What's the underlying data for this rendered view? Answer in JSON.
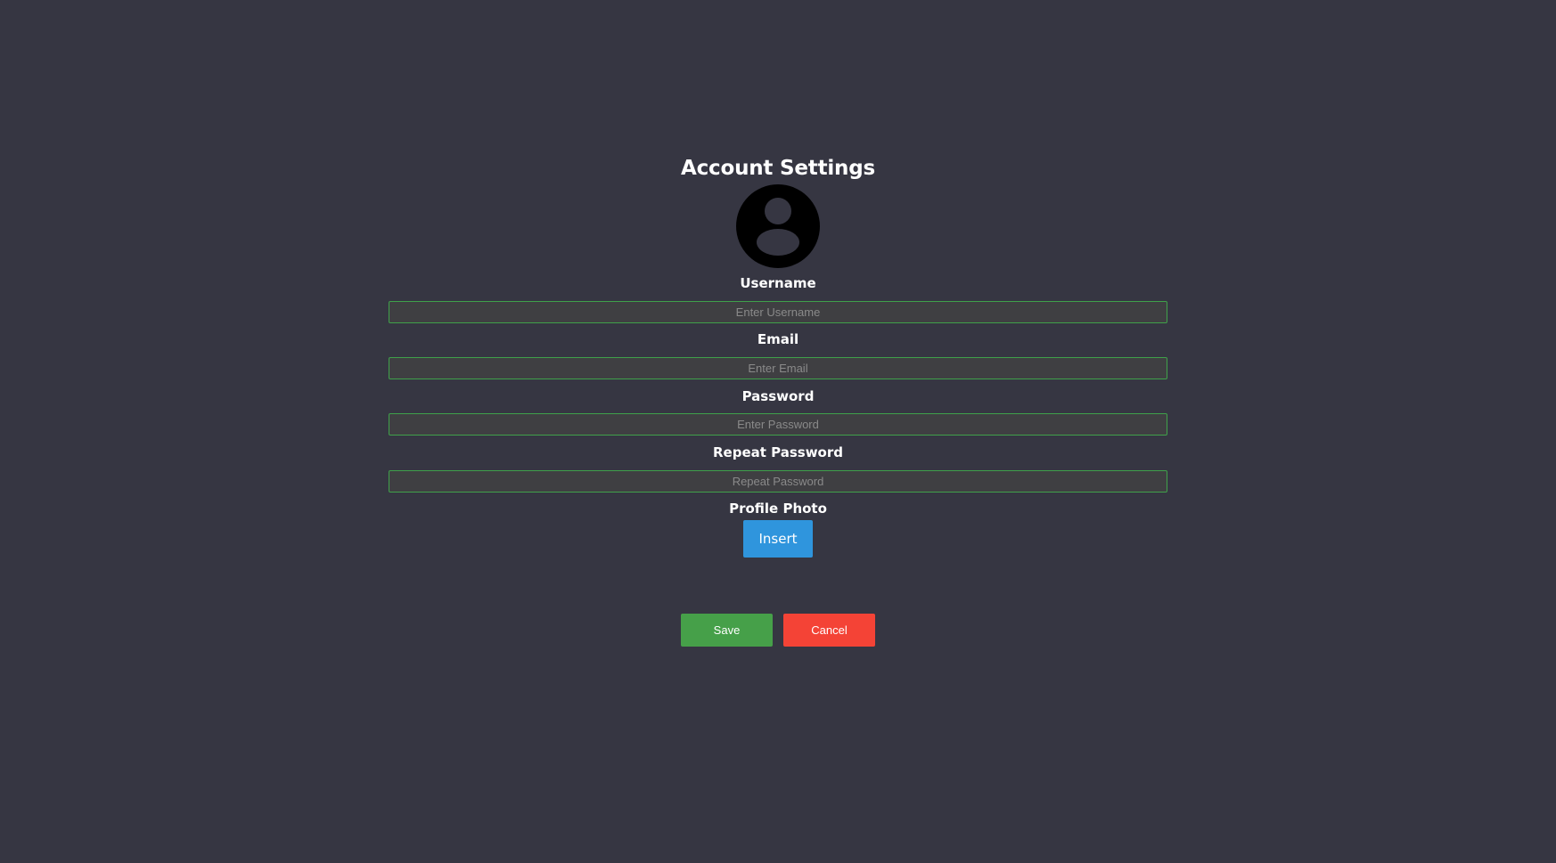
{
  "header": {
    "title": "Account Settings"
  },
  "avatar": {
    "icon": "user-avatar-icon"
  },
  "form": {
    "username": {
      "label": "Username",
      "placeholder": "Enter Username",
      "value": ""
    },
    "email": {
      "label": "Email",
      "placeholder": "Enter Email",
      "value": ""
    },
    "password": {
      "label": "Password",
      "placeholder": "Enter Password",
      "value": ""
    },
    "repeat_password": {
      "label": "Repeat Password",
      "placeholder": "Repeat Password",
      "value": ""
    },
    "profile_photo": {
      "label": "Profile Photo",
      "button_label": "Insert"
    }
  },
  "actions": {
    "save_label": "Save",
    "cancel_label": "Cancel"
  },
  "colors": {
    "background": "#363642",
    "input_border": "#3fa14a",
    "insert_button": "#2f95dd",
    "save_button": "#46a049",
    "cancel_button": "#f44336"
  }
}
